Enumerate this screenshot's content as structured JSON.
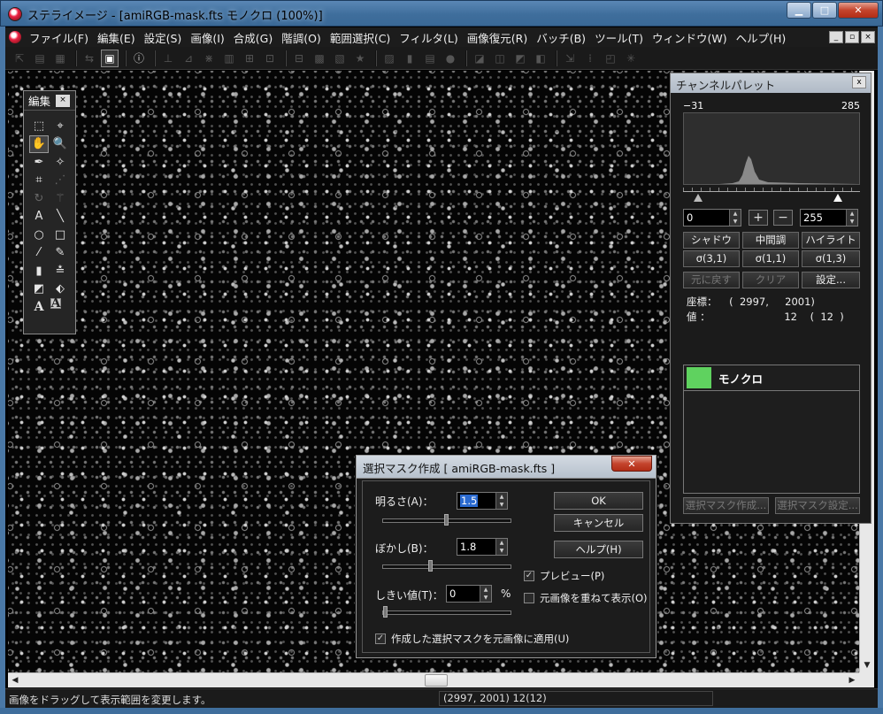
{
  "window": {
    "title": "ステライメージ - [amiRGB-mask.fts モノクロ (100%)]",
    "buttons": {
      "minimize": "▁",
      "maximize": "□",
      "close": "✕"
    }
  },
  "menubar": {
    "items": [
      "ファイル(F)",
      "編集(E)",
      "設定(S)",
      "画像(I)",
      "合成(G)",
      "階調(O)",
      "範囲選択(C)",
      "フィルタ(L)",
      "画像復元(R)",
      "バッチ(B)",
      "ツール(T)",
      "ウィンドウ(W)",
      "ヘルプ(H)"
    ],
    "mdi_buttons": [
      "_",
      "▫",
      "×"
    ]
  },
  "tool_palette": {
    "title": "編集",
    "close": "×",
    "tools": [
      {
        "name": "select-rect-icon",
        "glyph": "⬚"
      },
      {
        "name": "select-lasso-icon",
        "glyph": "⌖"
      },
      {
        "name": "hand-icon",
        "glyph": "✋"
      },
      {
        "name": "zoom-icon",
        "glyph": "🔍"
      },
      {
        "name": "dropper-icon",
        "glyph": "✒"
      },
      {
        "name": "star-pick-icon",
        "glyph": "✧"
      },
      {
        "name": "crop-icon",
        "glyph": "⌗"
      },
      {
        "name": "measure-icon",
        "glyph": "⋰"
      },
      {
        "name": "rotate-icon",
        "glyph": "↻"
      },
      {
        "name": "wand-icon",
        "glyph": "⚚"
      },
      {
        "name": "text-icon",
        "glyph": "A"
      },
      {
        "name": "line-icon",
        "glyph": "╲"
      },
      {
        "name": "ellipse-icon",
        "glyph": "○"
      },
      {
        "name": "rectangle-icon",
        "glyph": "□"
      },
      {
        "name": "pencil-icon",
        "glyph": "⁄"
      },
      {
        "name": "stamp-icon",
        "glyph": "✎"
      },
      {
        "name": "ruler-icon",
        "glyph": "▮"
      },
      {
        "name": "level-icon",
        "glyph": "≛"
      },
      {
        "name": "profile-icon",
        "glyph": "◩"
      },
      {
        "name": "fill-icon",
        "glyph": "⬖"
      },
      {
        "name": "font-outline-icon",
        "glyph": "A"
      },
      {
        "name": "font-box-icon",
        "glyph": "A"
      }
    ]
  },
  "channel_palette": {
    "title": "チャンネルパレット",
    "close": "x",
    "hist_min": "−31",
    "hist_max": "285",
    "shadow_value": "0",
    "highlight_value": "255",
    "plus": "+",
    "minus": "−",
    "buttons_row1": [
      "シャドウ",
      "中間調",
      "ハイライト"
    ],
    "buttons_row2": [
      "σ(3,1)",
      "σ(1,1)",
      "σ(1,3)"
    ],
    "buttons_row3": [
      "元に戻す",
      "クリア",
      "設定..."
    ],
    "coord_label": "座標：",
    "coord_value": "(  2997,     2001)",
    "value_label": "値  ：",
    "value_value": "12    (  12  )",
    "channel_name": "モノクロ",
    "channel_color": "#5fd25f",
    "footer_buttons": [
      "選択マスク作成...",
      "選択マスク設定..."
    ]
  },
  "dialog": {
    "title": "選択マスク作成 [ amiRGB-mask.fts ]",
    "brightness_label": "明るさ(A)：",
    "brightness_value": "1.5",
    "brightness_level": 0.5,
    "blur_label": "ぼかし(B)：",
    "blur_value": "1.8",
    "blur_level": 0.37,
    "threshold_label": "しきい値(T)：",
    "threshold_value": "0",
    "threshold_unit": "%",
    "threshold_level": 0.0,
    "ok": "OK",
    "cancel": "キャンセル",
    "help": "ヘルプ(H)",
    "preview_label": "プレビュー(P)",
    "preview_checked": true,
    "overlay_label": "元画像を重ねて表示(O)",
    "overlay_checked": false,
    "apply_label": "作成した選択マスクを元画像に適用(U)",
    "apply_checked": true
  },
  "statusbar": {
    "message": "画像をドラッグして表示範囲を変更します。",
    "info": "(2997, 2001) 12(12)"
  }
}
